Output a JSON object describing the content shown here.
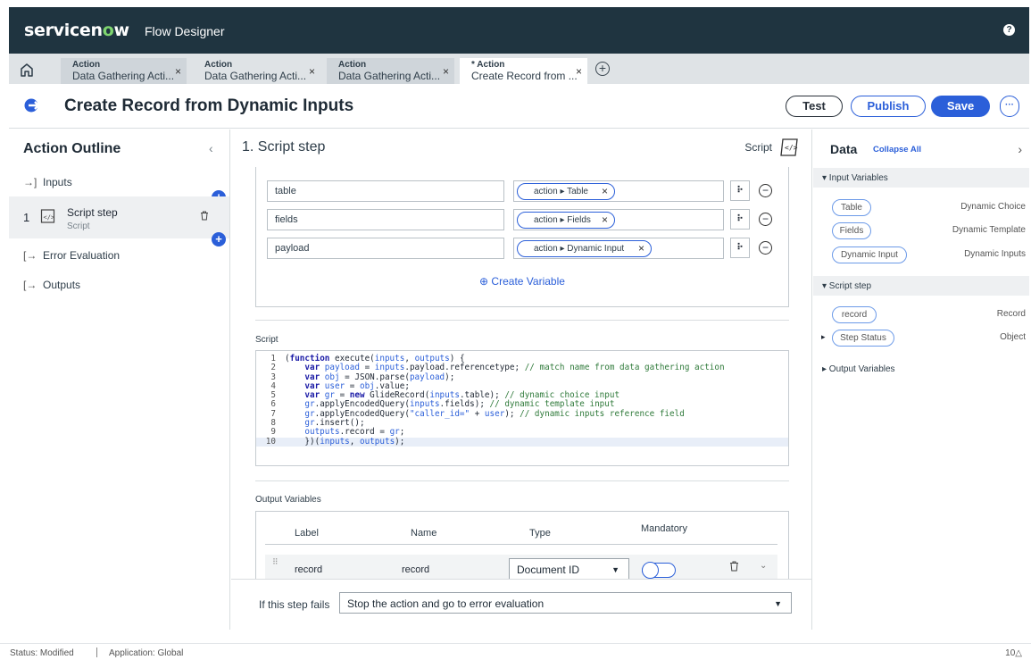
{
  "header": {
    "brand_pre": "servicen",
    "brand_o": "o",
    "brand_post": "w",
    "product": "Flow Designer",
    "help": "?"
  },
  "tabs": [
    {
      "type": "Action",
      "title": "Data Gathering Acti...",
      "close": "×"
    },
    {
      "type": "Action",
      "title": "Data Gathering Acti...",
      "close": "×"
    },
    {
      "type": "Action",
      "title": "Data Gathering Acti...",
      "close": "×"
    },
    {
      "type": "* Action",
      "title": "Create Record from ...",
      "close": "×"
    }
  ],
  "tab_add": "+",
  "title": {
    "text": "Create Record from Dynamic Inputs",
    "test": "Test",
    "publish": "Publish",
    "save": "Save",
    "more": "···"
  },
  "outline": {
    "heading": "Action Outline",
    "collapse": "‹",
    "inputs": "Inputs",
    "step_num": "1",
    "step_label": "Script step",
    "step_type": "Script",
    "error_eval": "Error Evaluation",
    "outputs": "Outputs",
    "plus": "+"
  },
  "step": {
    "title": "1. Script step",
    "type_label": "Script",
    "vars": [
      {
        "name": "table",
        "pill": "action ▸ Table",
        "x": "×"
      },
      {
        "name": "fields",
        "pill": "action ▸ Fields",
        "x": "×"
      },
      {
        "name": "payload",
        "pill": "action ▸ Dynamic Input",
        "x": "×"
      }
    ],
    "create_var": "⊕ Create Variable",
    "script_label": "Script",
    "output_label": "Output Variables",
    "ov_headers": {
      "label": "Label",
      "name": "Name",
      "type": "Type",
      "mandatory": "Mandatory"
    },
    "ov_row": {
      "label": "record",
      "name": "record",
      "type": "Document ID",
      "handle": "⠿"
    },
    "fail_label": "If this step fails",
    "fail_value": "Stop the action and go to error evaluation"
  },
  "code": [
    {
      "n": "1",
      "segs": [
        [
          "",
          "(",
          ""
        ],
        [
          "kw",
          "function",
          ""
        ],
        [
          "",
          " execute(",
          ""
        ],
        [
          "vr",
          "inputs",
          ""
        ],
        [
          "",
          ", ",
          ""
        ],
        [
          "vr",
          "outputs",
          ""
        ],
        [
          "",
          ") {",
          ""
        ]
      ]
    },
    {
      "n": "2",
      "segs": [
        [
          "",
          "    ",
          ""
        ],
        [
          "kw",
          "var",
          ""
        ],
        [
          "vr",
          " payload",
          ""
        ],
        [
          "",
          " = ",
          ""
        ],
        [
          "vr",
          "inputs",
          ""
        ],
        [
          "",
          ".payload.referencetype; ",
          ""
        ],
        [
          "cm",
          "// match name from data gathering action",
          ""
        ]
      ]
    },
    {
      "n": "3",
      "segs": [
        [
          "",
          "    ",
          ""
        ],
        [
          "kw",
          "var",
          ""
        ],
        [
          "vr",
          " obj",
          ""
        ],
        [
          "",
          " = JSON.parse(",
          ""
        ],
        [
          "vr",
          "payload",
          ""
        ],
        [
          "",
          ");",
          ""
        ]
      ]
    },
    {
      "n": "4",
      "segs": [
        [
          "",
          "    ",
          ""
        ],
        [
          "kw",
          "var",
          ""
        ],
        [
          "vr",
          " user",
          ""
        ],
        [
          "",
          " = ",
          ""
        ],
        [
          "vr",
          "obj",
          ""
        ],
        [
          "",
          ".value;",
          ""
        ]
      ]
    },
    {
      "n": "5",
      "segs": [
        [
          "",
          "    ",
          ""
        ],
        [
          "kw",
          "var",
          ""
        ],
        [
          "vr",
          " gr",
          ""
        ],
        [
          "",
          " = ",
          ""
        ],
        [
          "kw",
          "new",
          ""
        ],
        [
          "",
          " GlideRecord(",
          ""
        ],
        [
          "vr",
          "inputs",
          ""
        ],
        [
          "",
          ".table); ",
          ""
        ],
        [
          "cm",
          "// dynamic choice input",
          ""
        ]
      ]
    },
    {
      "n": "6",
      "segs": [
        [
          "",
          "    ",
          ""
        ],
        [
          "vr",
          "gr",
          ""
        ],
        [
          "",
          ".applyEncodedQuery(",
          ""
        ],
        [
          "vr",
          "inputs",
          ""
        ],
        [
          "",
          ".fields); ",
          ""
        ],
        [
          "cm",
          "// dynamic template input",
          ""
        ]
      ]
    },
    {
      "n": "7",
      "segs": [
        [
          "",
          "    ",
          ""
        ],
        [
          "vr",
          "gr",
          ""
        ],
        [
          "",
          ".applyEncodedQuery(",
          ""
        ],
        [
          "str",
          "\"caller_id=\"",
          ""
        ],
        [
          "",
          " + ",
          ""
        ],
        [
          "vr",
          "user",
          ""
        ],
        [
          "",
          "); ",
          ""
        ],
        [
          "cm",
          "// dynamic inputs reference field",
          ""
        ]
      ]
    },
    {
      "n": "8",
      "segs": [
        [
          "",
          "    ",
          ""
        ],
        [
          "vr",
          "gr",
          ""
        ],
        [
          "",
          ".insert();",
          ""
        ]
      ]
    },
    {
      "n": "9",
      "segs": [
        [
          "",
          "    ",
          ""
        ],
        [
          "vr",
          "outputs",
          ""
        ],
        [
          "",
          ".record = ",
          ""
        ],
        [
          "vr",
          "gr",
          ""
        ],
        [
          "",
          ";",
          ""
        ]
      ]
    },
    {
      "n": "10",
      "segs": [
        [
          "",
          "    })(",
          ""
        ],
        [
          "vr",
          "inputs",
          ""
        ],
        [
          "",
          ", ",
          ""
        ],
        [
          "vr",
          "outputs",
          ""
        ],
        [
          "",
          ");",
          ""
        ]
      ]
    }
  ],
  "data_panel": {
    "title": "Data",
    "collapse_all": "Collapse All",
    "chev": "›",
    "input_vars": "▾ Input Variables",
    "inputs": [
      {
        "pill": "Table",
        "type": "Dynamic Choice"
      },
      {
        "pill": "Fields",
        "type": "Dynamic Template"
      },
      {
        "pill": "Dynamic Input",
        "type": "Dynamic Inputs"
      }
    ],
    "script_step": "▾ Script step",
    "record_pill": "record",
    "record_type": "Record",
    "status_caret": "▸",
    "status_pill": "Step Status",
    "status_type": "Object",
    "output_vars": "▸ Output Variables"
  },
  "status": {
    "modified": "Status: Modified",
    "application": "Application: Global",
    "right": "10△"
  },
  "colors": {
    "navbar": "#1f3440",
    "accent": "#2b5fd9",
    "brand_o": "#7ed56f"
  }
}
